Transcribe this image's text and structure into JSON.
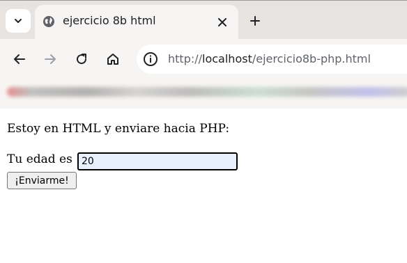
{
  "browser": {
    "tab": {
      "title": "ejercicio 8b html",
      "favicon": "globe-icon",
      "close_icon": "close-icon"
    },
    "new_tab_icon": "plus-icon",
    "tab_list_icon": "chevron-down-icon",
    "toolbar": {
      "back_icon": "back-arrow-icon",
      "forward_icon": "forward-arrow-icon",
      "reload_icon": "reload-icon",
      "home_icon": "home-icon",
      "site_info_icon": "info-icon"
    },
    "url": {
      "scheme": "http://",
      "host": "localhost",
      "path": "/ejercicio8b-php.html"
    }
  },
  "page": {
    "intro_text": "Estoy en HTML y enviare hacia PHP:",
    "age_label": "Tu edad es :",
    "age_value": "20",
    "submit_label": "¡Enviarme!"
  },
  "colors": {
    "input_background": "#e8f0fe",
    "chrome_background": "#e6e3e0",
    "toolbar_background": "#f7f5f3"
  }
}
